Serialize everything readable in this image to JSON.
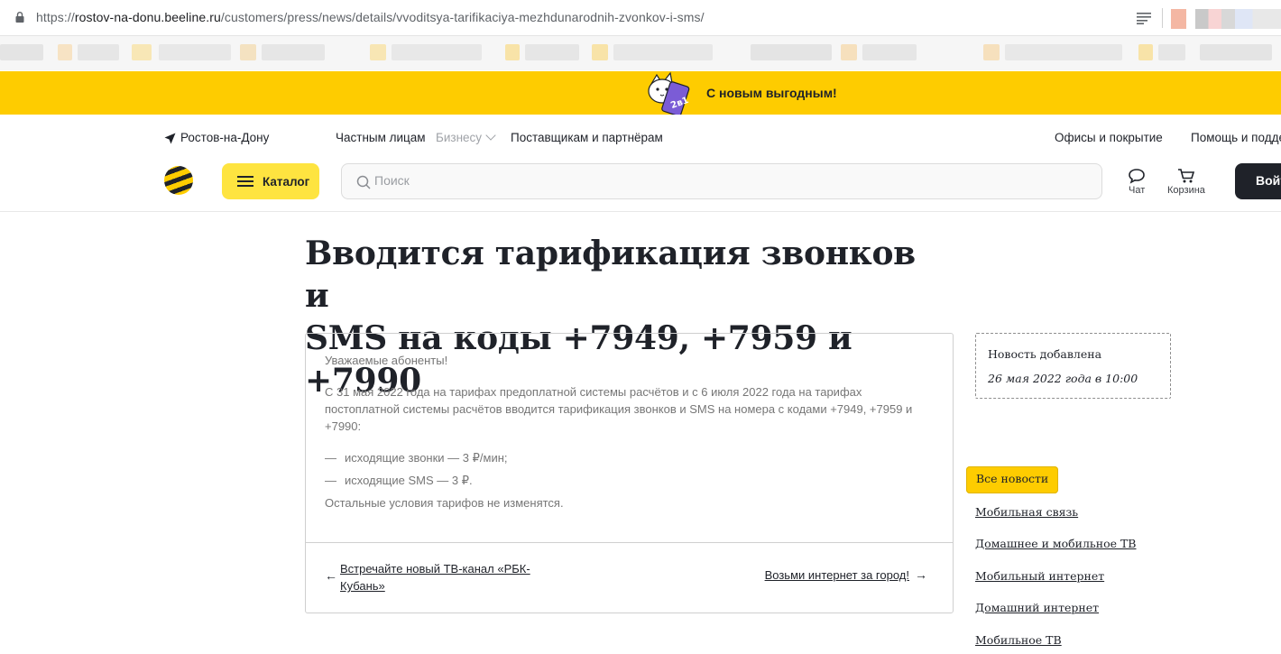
{
  "browser": {
    "url_prefix": "https://",
    "url_host": "rostov-na-donu.beeline.ru",
    "url_path": "/customers/press/news/details/vvoditsya-tarifikaciya-mezhdunarodnih-zvonkov-i-sms/"
  },
  "promo": {
    "text": "С новым выгодным!",
    "sticker_text": "2в1"
  },
  "header": {
    "city": "Ростов-на-Дону",
    "nav": [
      "Частным лицам",
      "Бизнесу",
      "Поставщикам и партнёрам"
    ],
    "right_nav": [
      "Офисы и покрытие",
      "Помощь и подде"
    ],
    "catalog_label": "Каталог",
    "search_placeholder": "Поиск",
    "chat_label": "Чат",
    "cart_label": "Корзина",
    "login_label": "Войт"
  },
  "article": {
    "title_line1": "Вводится тарификация звонков и",
    "title_line2": "SMS на коды +7949, +7959 и +7990",
    "greeting": "Уважаемые абоненты!",
    "paragraph": "С 31 мая 2022 года на тарифах предоплатной системы расчётов и с 6 июля 2022 года на тарифах постоплатной системы расчётов вводится тарификация звонков и SMS на номера с кодами +7949, +7959 и +7990:",
    "list": [
      "исходящие звонки — 3 ₽/мин;",
      "исходящие SMS — 3 ₽."
    ],
    "dash": "—",
    "closing": "Остальные условия тарифов не изменятся.",
    "prev_link": "Встречайте новый ТВ-канал «РБК-Кубань»",
    "prev_arrow": "←",
    "next_link": "Возьми интернет за город!",
    "next_arrow": "→"
  },
  "sidebar": {
    "date_label": "Новость добавлена",
    "date_value": "26 мая 2022 года в 10:00",
    "active_category": "Все новости",
    "categories": [
      "Мобильная связь",
      "Домашнее и мобильное ТВ",
      "Мобильный интернет",
      "Домашний интернет",
      "Мобильное ТВ"
    ]
  },
  "colors": {
    "brand_yellow": "#fecc00",
    "text_dark": "#1f2229",
    "muted": "#767676"
  }
}
